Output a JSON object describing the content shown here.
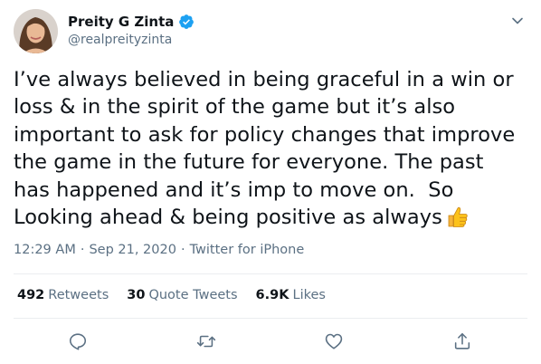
{
  "user": {
    "display_name": "Preity G Zinta",
    "handle": "@realpreityzinta",
    "verified": true
  },
  "tweet": {
    "text": "I’ve always believed in being graceful in a win or\nloss & in the spirit of the game but it’s also\nimportant to ask for policy changes that improve\nthe game in the future for everyone. The past\nhas happened and it’s imp to move on.  So\nLooking ahead & being positive as always",
    "emoji": "thumbs-up"
  },
  "meta": {
    "time": "12:29 AM",
    "separator": "·",
    "date": "Sep 21, 2020",
    "source": "Twitter for iPhone"
  },
  "stats": {
    "retweets_count": "492",
    "retweets_label": "Retweets",
    "quotes_count": "30",
    "quotes_label": "Quote Tweets",
    "likes_count": "6.9K",
    "likes_label": "Likes"
  },
  "actions": [
    "reply-icon",
    "retweet-icon",
    "like-icon",
    "share-icon"
  ],
  "colors": {
    "text": "#0f1419",
    "secondary": "#5b7083",
    "verified": "#1da1f2",
    "divider": "#ebeef0"
  }
}
